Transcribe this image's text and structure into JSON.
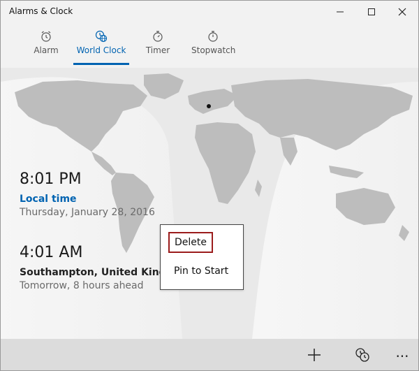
{
  "window": {
    "title": "Alarms & Clock",
    "controls": [
      "minimize-icon",
      "maximize-icon",
      "close-icon"
    ]
  },
  "tabs": [
    {
      "label": "Alarm",
      "icon": "alarm-clock-icon",
      "active": false
    },
    {
      "label": "World Clock",
      "icon": "world-clock-icon",
      "active": true
    },
    {
      "label": "Timer",
      "icon": "timer-icon",
      "active": false
    },
    {
      "label": "Stopwatch",
      "icon": "stopwatch-icon",
      "active": false
    }
  ],
  "clocks": [
    {
      "time": "8:01 PM",
      "place": "Local time",
      "sub": "Thursday, January 28, 2016"
    },
    {
      "time": "4:01 AM",
      "place": "Southampton, United Kingdo",
      "sub": "Tomorrow, 8 hours ahead"
    }
  ],
  "context_menu": {
    "items": [
      {
        "label": "Delete",
        "focused": true
      },
      {
        "label": "Pin to Start",
        "focused": false
      }
    ]
  },
  "bottom_bar": {
    "icons": [
      "add-icon",
      "compare-clocks-icon",
      "more-icon"
    ],
    "more_glyph": "..."
  },
  "colors": {
    "accent": "#0063b1",
    "focus_border": "#9b1c1c",
    "bottom_bar": "#dcdcdc",
    "land": "#bdbdbd",
    "map_background": "#eaeaea"
  }
}
